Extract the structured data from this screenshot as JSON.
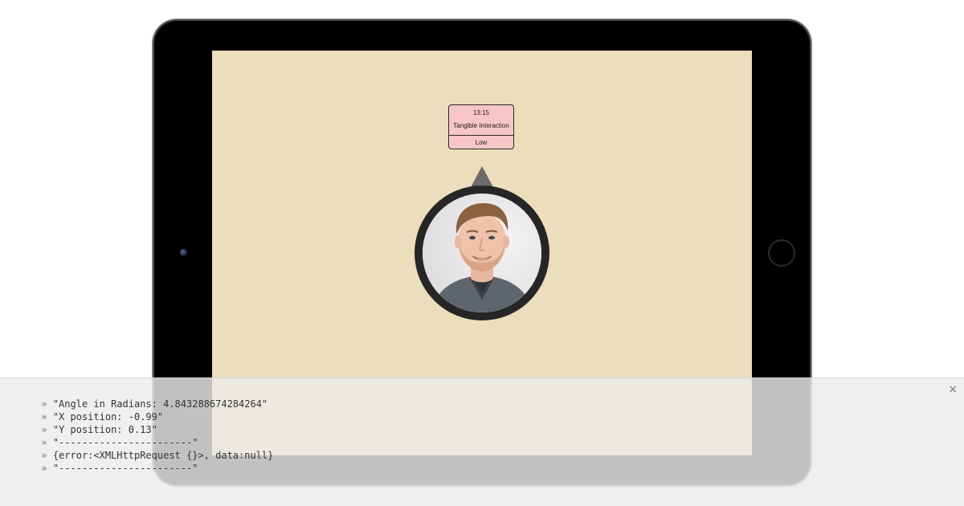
{
  "event_card": {
    "time": "13:15",
    "title": "Tangible Interaction",
    "priority": "Low"
  },
  "icons": {
    "pointer": "triangle-up-pointer-icon",
    "avatar": "user-avatar-photo",
    "close": "close-icon",
    "camera": "front-camera-icon",
    "home": "home-button-icon"
  },
  "colors": {
    "screen_bg": "#ecdebc",
    "card_bg": "#f7c6c6",
    "pointer": "#6b6b6b",
    "avatar_ring": "#262626"
  },
  "console": {
    "prompt": "»",
    "close_label": "×",
    "lines": [
      "\"Angle in Radians: 4.843288674284264\"",
      "\"X position: -0.99\"",
      "\"Y position: 0.13\"",
      "\"-----------------------\"",
      "{error:<XMLHttpRequest {}>, data:null}",
      "\"-----------------------\""
    ]
  }
}
